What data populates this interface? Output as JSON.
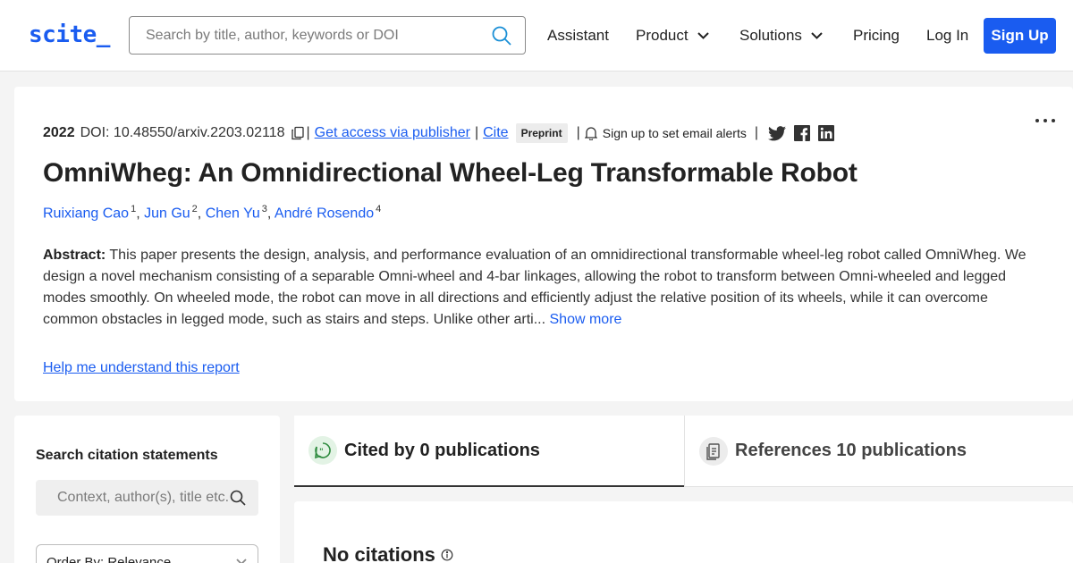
{
  "header": {
    "logo": "scite_",
    "search_placeholder": "Search by title, author, keywords or DOI",
    "nav": {
      "assistant": "Assistant",
      "product": "Product",
      "solutions": "Solutions",
      "pricing": "Pricing",
      "login": "Log In",
      "signup": "Sign Up"
    }
  },
  "paper": {
    "year": "2022",
    "doi": "DOI: 10.48550/arxiv.2203.02118",
    "sep": "|",
    "access_link": "Get access via publisher",
    "cite_link": "Cite",
    "badge": "Preprint",
    "alerts": "Sign up to set email alerts",
    "title": "OmniWheg: An Omnidirectional Wheel-Leg Transformable Robot",
    "authors": [
      {
        "name": "Ruixiang Cao",
        "sup": "1"
      },
      {
        "name": "Jun Gu",
        "sup": "2"
      },
      {
        "name": "Chen Yu",
        "sup": "3"
      },
      {
        "name": "André Rosendo",
        "sup": "4"
      }
    ],
    "author_sep": ", ",
    "abstract_label": "Abstract:",
    "abstract_text": " This paper presents the design, analysis, and performance evaluation of an omnidirectional transformable wheel-leg robot called OmniWheg. We design a novel mechanism consisting of a separable Omni-wheel and 4-bar linkages, allowing the robot to transform between Omni-wheeled and legged modes smoothly. On wheeled mode, the robot can move in all directions and efficiently adjust the relative position of its wheels, while it can overcome common obstacles in legged mode, such as stairs and steps. Unlike other arti...",
    "show_more": " Show more",
    "help_link": "Help me understand this report"
  },
  "sidebar": {
    "heading": "Search citation statements",
    "input_placeholder": "Context, author(s), title etc.",
    "order_label": "Order By: Relevance"
  },
  "tabs": {
    "cited_by": "Cited by 0 publications",
    "references": "References 10 publications"
  },
  "results": {
    "no_citations": "No citations"
  },
  "colors": {
    "accent": "#1a5cf0",
    "cited_icon": "#2e8b3e"
  }
}
